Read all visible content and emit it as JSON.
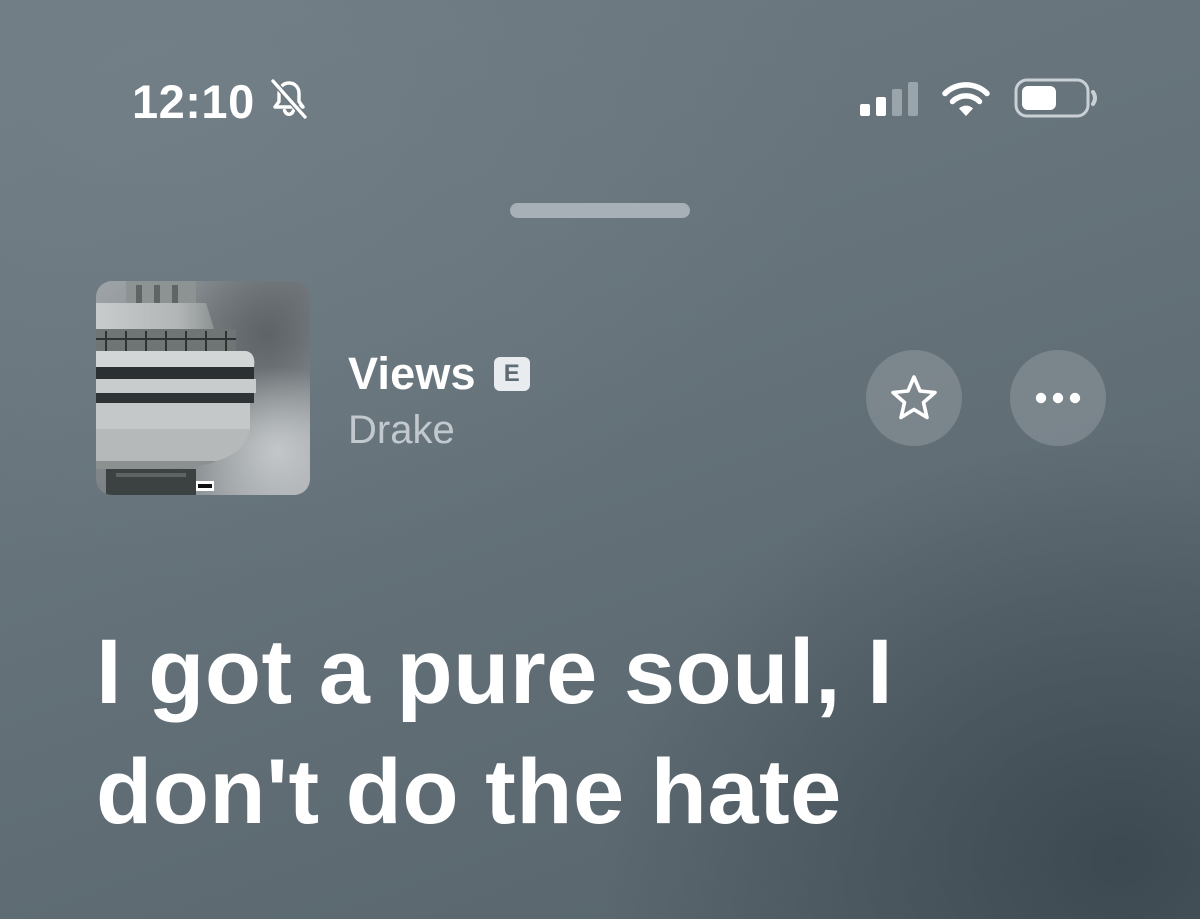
{
  "status_bar": {
    "time": "12:10",
    "icons": [
      "bell-slash-icon",
      "cellular-signal-icon",
      "wifi-icon",
      "battery-icon"
    ]
  },
  "album": {
    "title": "Views",
    "explicit_badge": "E",
    "artist": "Drake",
    "artwork": "album-artwork-tower"
  },
  "actions": {
    "favorite_icon": "star-icon",
    "more_icon": "ellipsis-icon"
  },
  "lyrics": {
    "lines": [
      "I got a pure soul, I",
      "don't do the hate"
    ]
  },
  "colors": {
    "background": "#66737b",
    "text_primary": "#ffffff",
    "text_secondary": "#c2c9ce"
  }
}
